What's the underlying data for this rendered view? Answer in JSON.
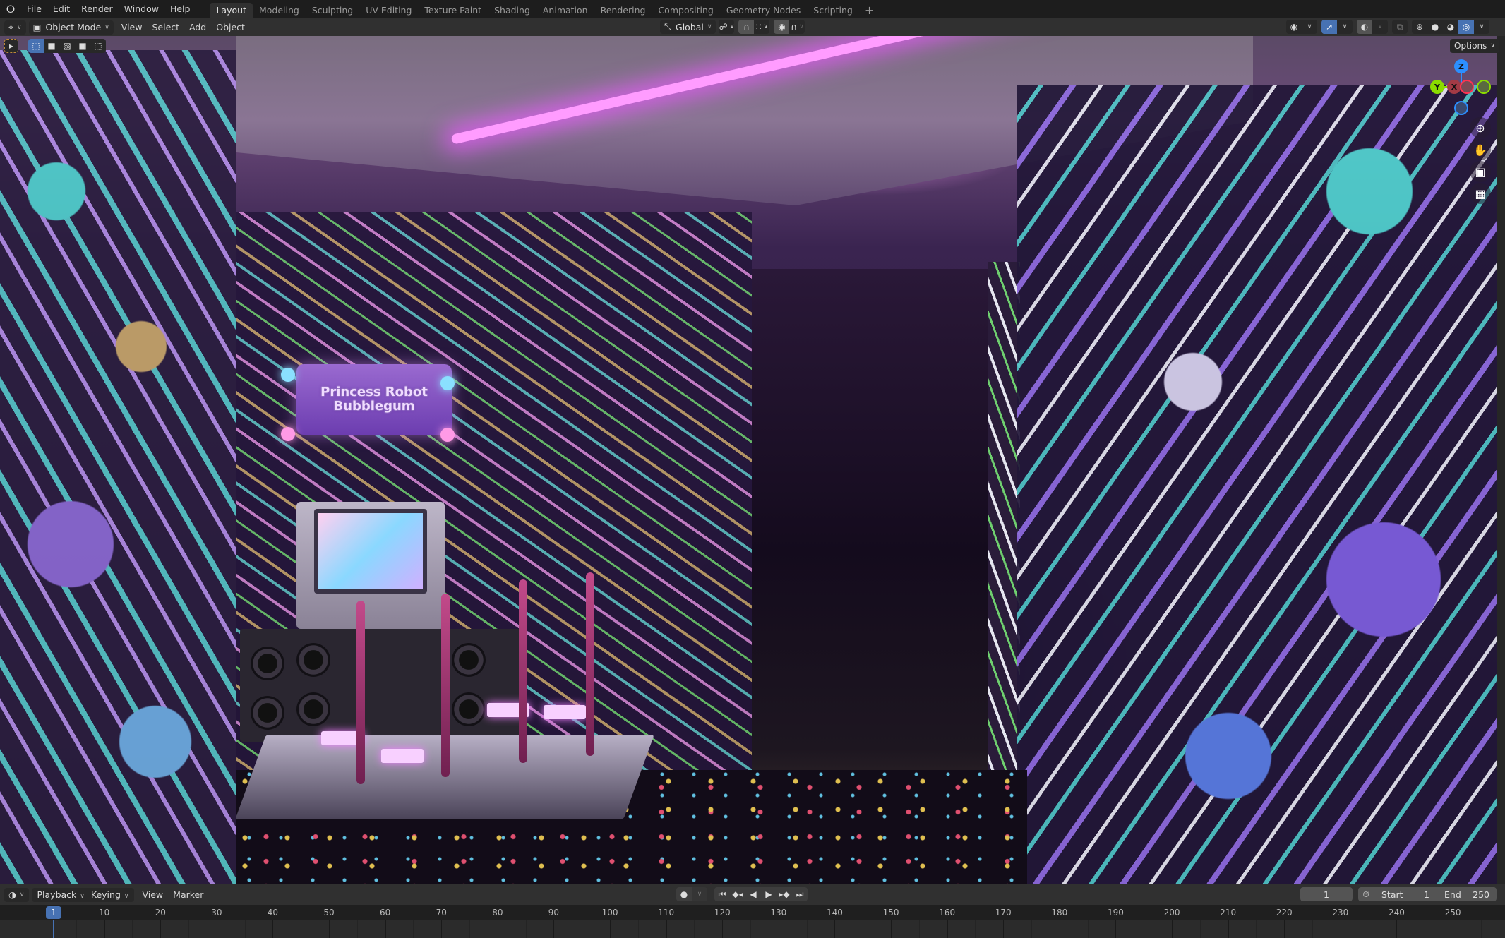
{
  "topbar": {
    "logo_icon": "blender-logo-icon",
    "menus": [
      "File",
      "Edit",
      "Render",
      "Window",
      "Help"
    ],
    "workspaces": [
      {
        "label": "Layout",
        "active": true
      },
      {
        "label": "Modeling",
        "active": false
      },
      {
        "label": "Sculpting",
        "active": false
      },
      {
        "label": "UV Editing",
        "active": false
      },
      {
        "label": "Texture Paint",
        "active": false
      },
      {
        "label": "Shading",
        "active": false
      },
      {
        "label": "Animation",
        "active": false
      },
      {
        "label": "Rendering",
        "active": false
      },
      {
        "label": "Compositing",
        "active": false
      },
      {
        "label": "Geometry Nodes",
        "active": false
      },
      {
        "label": "Scripting",
        "active": false
      }
    ],
    "add_workspace": "+"
  },
  "viewport_header": {
    "editor_type_icon": "3d-viewport-icon",
    "mode": "Object Mode",
    "menus": [
      "View",
      "Select",
      "Add",
      "Object"
    ],
    "transform_orientation": "Global",
    "pivot_icon": "pivot-point-icon",
    "snap_icon": "magnet-icon",
    "snap_target_icon": "snap-increment-icon",
    "proportional_icon": "proportional-edit-icon",
    "falloff_icon": "falloff-curve-icon",
    "visibility_icon": "eye-icon",
    "gizmo_icon": "gizmo-icon",
    "overlay_icon": "overlay-icon",
    "xray_icon": "xray-icon",
    "shading_modes": [
      {
        "name": "wireframe",
        "active": false
      },
      {
        "name": "solid",
        "active": false
      },
      {
        "name": "material-preview",
        "active": false
      },
      {
        "name": "rendered",
        "active": true
      }
    ]
  },
  "tool_settings": {
    "select_tool_icon": "select-box-icon",
    "select_modes": [
      "set",
      "extend",
      "subtract",
      "invert",
      "intersect"
    ],
    "active_select_mode": 0,
    "options_label": "Options"
  },
  "viewport": {
    "scene_sign_text": [
      "Princess Robot",
      "Bubblegum"
    ],
    "gizmo_axes": [
      "Z",
      "Y",
      "X"
    ],
    "nav_buttons": [
      "zoom-icon",
      "hand-pan-icon",
      "camera-icon",
      "ortho-grid-icon"
    ],
    "colors": {
      "neon": "#ff9cff",
      "x_axis": "#ff3352",
      "y_axis": "#8bdc00",
      "z_axis": "#2c8fff"
    }
  },
  "timeline": {
    "editor_icon": "clock-icon",
    "menus": [
      {
        "label": "Playback",
        "dropdown": true
      },
      {
        "label": "Keying",
        "dropdown": true
      },
      {
        "label": "View",
        "dropdown": false
      },
      {
        "label": "Marker",
        "dropdown": false
      }
    ],
    "record_icon": "record-icon",
    "transport": [
      "jump-start-icon",
      "prev-keyframe-icon",
      "play-reverse-icon",
      "play-icon",
      "next-keyframe-icon",
      "jump-end-icon"
    ],
    "current_frame": "1",
    "stopwatch_icon": "stopwatch-icon",
    "start_label": "Start",
    "start_value": "1",
    "end_label": "End",
    "end_value": "250",
    "ruler_ticks": [
      "10",
      "20",
      "30",
      "40",
      "50",
      "60",
      "70",
      "80",
      "90",
      "100",
      "110",
      "120",
      "130",
      "140",
      "150",
      "160",
      "170",
      "180",
      "190",
      "200",
      "210",
      "220",
      "230",
      "240",
      "250"
    ],
    "playhead_frame": "1",
    "accent": "#4772b3"
  }
}
